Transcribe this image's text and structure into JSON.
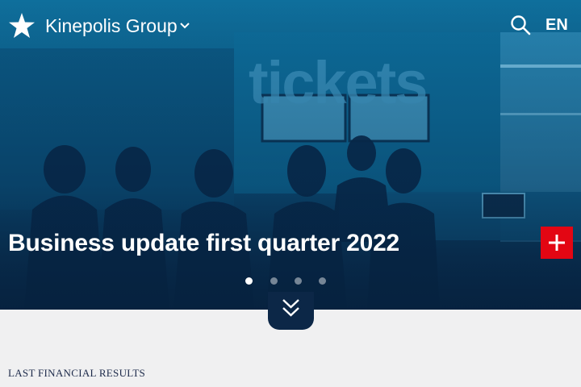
{
  "header": {
    "brand": "Kinepolis Group",
    "language": "EN",
    "icons": [
      "star-logo-icon",
      "chevron-down-icon",
      "search-icon"
    ]
  },
  "hero": {
    "background_text": "tickets",
    "headline": "Business update first quarter 2022",
    "slides_total": 4,
    "active_slide": 1
  },
  "section": {
    "label": "LAST FINANCIAL RESULTS"
  },
  "colors": {
    "accent_red": "#e30613",
    "navy": "#0c2747",
    "hero_blue": "#0b5a85",
    "page_bg": "#f0f0f1"
  }
}
